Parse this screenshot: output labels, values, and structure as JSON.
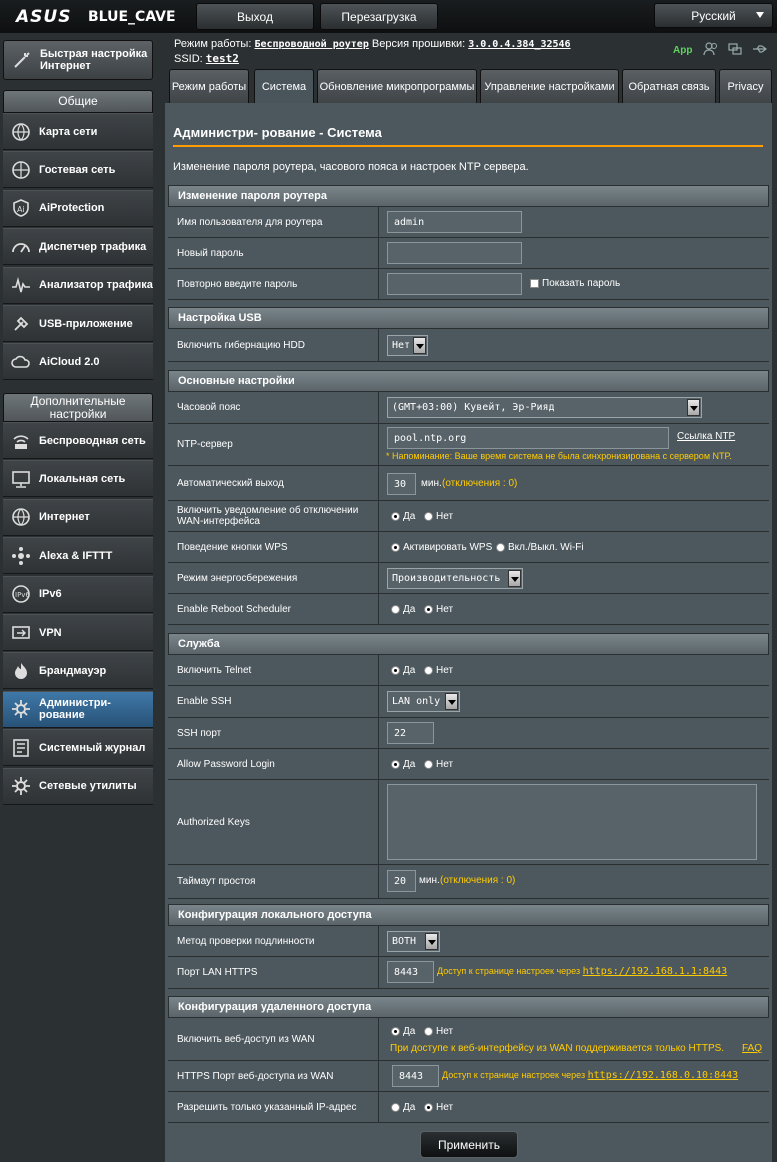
{
  "header": {
    "logo": "ASUS",
    "model": "BLUE_CAVE",
    "logout": "Выход",
    "reboot": "Перезагрузка",
    "language": "Русский"
  },
  "status": {
    "mode_label": "Режим работы:",
    "mode_value": "Беспроводной роутер",
    "fw_label": "Версия прошивки:",
    "fw_value": "3.0.0.4.384_32546",
    "ssid_label": "SSID:",
    "ssid_value": "test2",
    "app": "App"
  },
  "sidebar": {
    "quick": "Быстрая настройка Интернет",
    "general_head": "Общие",
    "general": [
      {
        "label": "Карта сети",
        "icon": "network-map-icon"
      },
      {
        "label": "Гостевая сеть",
        "icon": "guest-network-icon"
      },
      {
        "label": "AiProtection",
        "icon": "aiprotection-icon"
      },
      {
        "label": "Диспетчер трафика",
        "icon": "traffic-manager-icon"
      },
      {
        "label": "Анализатор трафика",
        "icon": "traffic-analyzer-icon"
      },
      {
        "label": "USB-приложение",
        "icon": "usb-icon"
      },
      {
        "label": "AiCloud 2.0",
        "icon": "aicloud-icon"
      }
    ],
    "advanced_head": "Дополнительные настройки",
    "advanced": [
      {
        "label": "Беспроводная сеть",
        "icon": "wireless-icon"
      },
      {
        "label": "Локальная сеть",
        "icon": "lan-icon"
      },
      {
        "label": "Интернет",
        "icon": "internet-icon"
      },
      {
        "label": "Alexa & IFTTT",
        "icon": "alexa-icon"
      },
      {
        "label": "IPv6",
        "icon": "ipv6-icon"
      },
      {
        "label": "VPN",
        "icon": "vpn-icon"
      },
      {
        "label": "Брандмауэр",
        "icon": "firewall-icon"
      },
      {
        "label": "Администри- рование",
        "icon": "admin-icon"
      },
      {
        "label": "Системный журнал",
        "icon": "system-log-icon"
      },
      {
        "label": "Сетевые утилиты",
        "icon": "network-tools-icon"
      }
    ]
  },
  "tabs": [
    {
      "label": "Режим работы"
    },
    {
      "label": "Система"
    },
    {
      "label": "Обновление микропрограммы"
    },
    {
      "label": "Управление настройками"
    },
    {
      "label": "Обратная связь"
    },
    {
      "label": "Privacy"
    }
  ],
  "page": {
    "title": "Администри- рование - Система",
    "description": "Изменение пароля роутера, часового пояса и настроек NTP сервера."
  },
  "sections": {
    "password": "Изменение пароля роутера",
    "usb": "Настройка USB",
    "basic": "Основные настройки",
    "service": "Служба",
    "local": "Конфигурация локального доступа",
    "remote": "Конфигурация удаленного доступа"
  },
  "fields": {
    "username_label": "Имя пользователя для роутера",
    "username_value": "admin",
    "newpass_label": "Новый пароль",
    "repass_label": "Повторно введите пароль",
    "showpass": "Показать пароль",
    "hdd_label": "Включить гибернацию HDD",
    "hdd_value": "Нет",
    "tz_label": "Часовой пояс",
    "tz_value": "(GMT+03:00) Кувейт, Эр-Рияд",
    "ntp_label": "NTP-сервер",
    "ntp_value": "pool.ntp.org",
    "ntp_link": "Ссылка NTP",
    "ntp_note": "* Напоминание: Ваше время система не была синхронизирована с сервером NTP.",
    "autologout_label": "Автоматический выход",
    "autologout_value": "30",
    "autologout_unit": "мин.",
    "autologout_note": "(отключения : 0)",
    "wannotify_label": "Включить уведомление об отключении WAN-интерфейса",
    "yes": "Да",
    "no": "Нет",
    "wps_label": "Поведение кнопки WPS",
    "wps_opt1": "Активировать WPS",
    "wps_opt2": "Вкл./Выкл. Wi-Fi",
    "power_label": "Режим энергосбережения",
    "power_value": "Производительность",
    "reboot_label": "Enable Reboot Scheduler",
    "telnet_label": "Включить Telnet",
    "ssh_label": "Enable SSH",
    "ssh_value": "LAN only",
    "sshport_label": "SSH порт",
    "sshport_value": "22",
    "pwlogin_label": "Allow Password Login",
    "authkeys_label": "Authorized Keys",
    "idle_label": "Таймаут простоя",
    "idle_value": "20",
    "idle_unit": "мин.",
    "idle_note": "(отключения : 0)",
    "auth_label": "Метод проверки подлинности",
    "auth_value": "BOTH",
    "lanhttps_label": "Порт LAN HTTPS",
    "lanhttps_value": "8443",
    "lanhttps_note": "Доступ к странице настроек через",
    "lanhttps_url": "https://192.168.1.1:8443",
    "wanweb_label": "Включить веб-доступ из WAN",
    "wanweb_note": "При доступе к веб-интерфейсу из WAN поддерживается только HTTPS.",
    "wanweb_faq": "FAQ",
    "wanport_label": "HTTPS Порт веб-доступа из WAN",
    "wanport_value": "8443",
    "wanport_note": "Доступ к странице настроек через",
    "wanport_url": "https://192.168.0.10:8443",
    "iponly_label": "Разрешить только указанный IP-адрес"
  },
  "apply": "Применить"
}
